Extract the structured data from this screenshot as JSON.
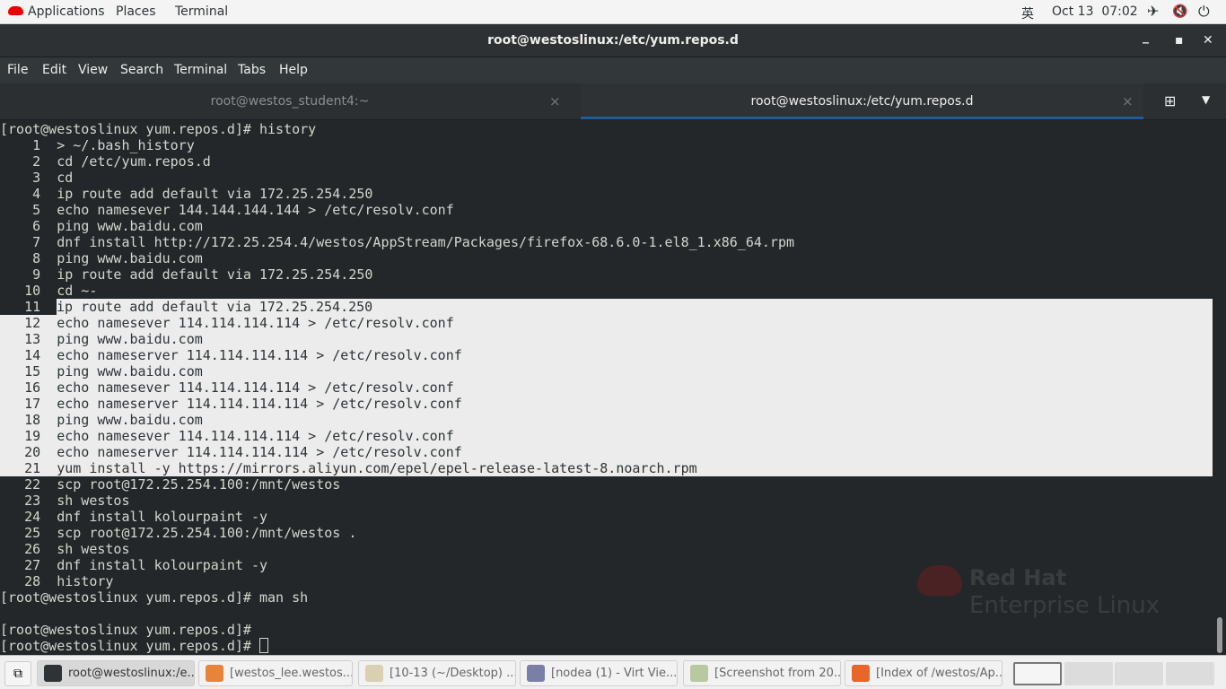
{
  "topbar": {
    "applications": "Applications",
    "places": "Places",
    "terminal": "Terminal",
    "input_method": "英",
    "clock": "Oct 13  07:02",
    "icons": [
      "airplane-icon",
      "volume-muted-icon",
      "power-icon"
    ]
  },
  "window": {
    "title": "root@westoslinux:/etc/yum.repos.d",
    "minimize": "_",
    "maximize": "▪",
    "close": "✕"
  },
  "menu": [
    "File",
    "Edit",
    "View",
    "Search",
    "Terminal",
    "Tabs",
    "Help"
  ],
  "tabs": [
    {
      "label": "root@westos_student4:~",
      "active": false
    },
    {
      "label": "root@westoslinux:/etc/yum.repos.d",
      "active": true
    }
  ],
  "tab_close": "×",
  "accent": "#215d9c",
  "terminal": {
    "lines": [
      {
        "text": "[root@westoslinux yum.repos.d]# history"
      },
      {
        "text": "    1  > ~/.bash_history"
      },
      {
        "text": "    2  cd /etc/yum.repos.d"
      },
      {
        "text": "    3  cd"
      },
      {
        "text": "    4  ip route add default via 172.25.254.250"
      },
      {
        "text": "    5  echo namesever 144.144.144.144 > /etc/resolv.conf"
      },
      {
        "text": "    6  ping www.baidu.com"
      },
      {
        "text": "    7  dnf install http://172.25.254.4/westos/AppStream/Packages/firefox-68.6.0-1.el8_1.x86_64.rpm"
      },
      {
        "text": "    8  ping www.baidu.com"
      },
      {
        "text": "    9  ip route add default via 172.25.254.250"
      },
      {
        "text": "   10  cd ~-"
      },
      {
        "text": "   11  ",
        "selected": "ip route add default via 172.25.254.250"
      },
      {
        "text": "   12  echo namesever 114.114.114.114 > /etc/resolv.conf",
        "full": true
      },
      {
        "text": "   13  ping www.baidu.com",
        "full": true
      },
      {
        "text": "   14  echo nameserver 114.114.114.114 > /etc/resolv.conf",
        "full": true
      },
      {
        "text": "   15  ping www.baidu.com",
        "full": true
      },
      {
        "text": "   16  echo namesever 114.114.114.114 > /etc/resolv.conf",
        "full": true
      },
      {
        "text": "   17  echo nameserver 114.114.114.114 > /etc/resolv.conf",
        "full": true
      },
      {
        "text": "   18  ping www.baidu.com",
        "full": true
      },
      {
        "text": "   19  echo namesever 114.114.114.114 > /etc/resolv.conf",
        "full": true
      },
      {
        "text": "   20  echo nameserver 114.114.114.114 > /etc/resolv.conf",
        "full": true
      },
      {
        "text": "   21  yum install -y https://mirrors.aliyun.com/epel/epel-release-latest-8.noarch.rpm",
        "full": true
      },
      {
        "text": "   22  scp root@172.25.254.100:/mnt/westos"
      },
      {
        "text": "   23  sh westos"
      },
      {
        "text": "   24  dnf install kolourpaint -y"
      },
      {
        "text": "   25  scp root@172.25.254.100:/mnt/westos ."
      },
      {
        "text": "   26  sh westos"
      },
      {
        "text": "   27  dnf install kolourpaint -y"
      },
      {
        "text": "   28  history"
      },
      {
        "text": "[root@westoslinux yum.repos.d]# man sh"
      },
      {
        "text": ""
      },
      {
        "text": "[root@westoslinux yum.repos.d]# "
      },
      {
        "text": "[root@westoslinux yum.repos.d]# ",
        "cursor": true
      }
    ]
  },
  "wallpaper_logo": {
    "line1": "Red Hat",
    "line2": "Enterprise Linux"
  },
  "taskbar": {
    "items": [
      {
        "label": "root@westoslinux:/e...",
        "active": true,
        "icon": "terminal-icon",
        "color": "#2e3436"
      },
      {
        "label": "[westos_lee.westos....",
        "icon": "remote-viewer-icon",
        "color": "#e8843a"
      },
      {
        "label": "[10-13 (~/Desktop) ...",
        "icon": "text-editor-icon",
        "color": "#d8d0b0"
      },
      {
        "label": "[nodea (1) - Virt Vie...",
        "icon": "virt-viewer-icon",
        "color": "#7a7fa8"
      },
      {
        "label": "[Screenshot from 20...",
        "icon": "image-viewer-icon",
        "color": "#b8c8a0"
      },
      {
        "label": "[Index of /westos/Ap...",
        "icon": "firefox-icon",
        "color": "#e8662a"
      }
    ]
  }
}
